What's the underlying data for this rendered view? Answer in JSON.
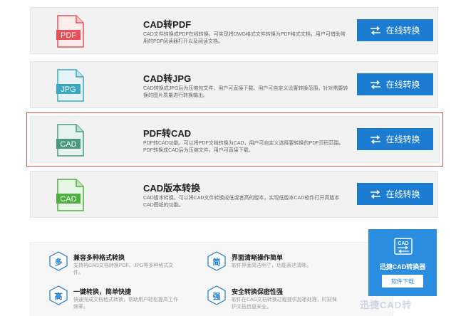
{
  "cards": [
    {
      "icon_label": "PDF",
      "icon_color": "#e8515a",
      "title": "CAD转PDF",
      "desc": "CAD文件转换成PDF在线转换，可实现将DWG格式文件转换为PDF格式文档，用户可借助常用的PDF阅读器打开以及阅读文档。",
      "button": "在线转换"
    },
    {
      "icon_label": "JPG",
      "icon_color": "#3aa8c1",
      "title": "CAD转JPG",
      "desc": "CAD转换成JPG后为压缩包文件，用户可直接下载。用户可自定义设置转换范围，针对需要转换的图片质量进行转换输出。",
      "button": "在线转换"
    },
    {
      "icon_label": "CAD",
      "icon_color": "#4a9a7e",
      "title": "PDF转CAD",
      "desc": "PDF转CAD功能，可以将PDF文档转换为CAD，用户可自定义选择要转换的PDF页码范围。PDF转换成CAD后为压缩文件，用户可直接下载。",
      "button": "在线转换"
    },
    {
      "icon_label": "CAD",
      "icon_color": "#4cae3e",
      "title": "CAD版本转换",
      "desc": "CAD版本转换，可以将CAD文件转换成低或者高的版本，实现低版本CAD软件打开高版本CAD图纸的功能。",
      "button": "在线转换"
    }
  ],
  "features": [
    {
      "char": "多",
      "title": "兼容多种格式转换",
      "desc": "支持将CAD文档转换PDF、JPG等多种格式文件。"
    },
    {
      "char": "简",
      "title": "界面清晰操作简单",
      "desc": "软件界面简洁明了，功能表述清晰。"
    },
    {
      "char": "高",
      "title": "一键转换，简单快捷",
      "desc": "快速完成文档格式转换，帮助用户轻松提高工作效率。"
    },
    {
      "char": "强",
      "title": "安全转换保密性强",
      "desc": "软件在CAD文档转换过程提供加密处理，时刻保护文档信息安全。"
    }
  ],
  "promo": {
    "logo_text": "CAD",
    "name": "迅捷CAD转换器",
    "button": "软件下载"
  },
  "watermark": "迅捷CAD转",
  "colors": {
    "button_blue": "#1b7cd2",
    "selected_border": "#d9534f",
    "promo_blue": "#2a8de0"
  }
}
